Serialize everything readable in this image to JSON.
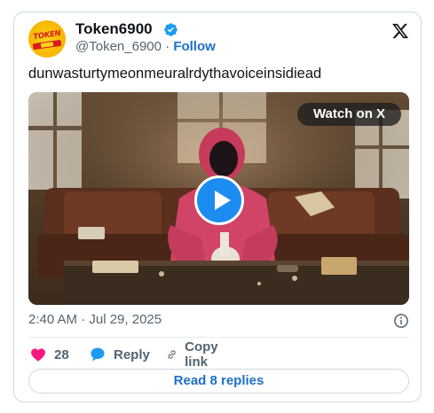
{
  "author": {
    "display_name": "Token6900",
    "handle": "@Token_6900",
    "separator": " · ",
    "follow_label": "Follow",
    "avatar_logo_text": "TOKEN"
  },
  "tweet": {
    "text": "dunwasturtymeonmeuralrdythavoiceinsidiead",
    "timestamp": "2:40 AM · Jul 29, 2025"
  },
  "media": {
    "watch_label": "Watch on X"
  },
  "actions": {
    "like_count": "28",
    "reply_label": "Reply",
    "copy_link_label": "Copy link"
  },
  "footer": {
    "read_replies_label": "Read 8 replies"
  },
  "colors": {
    "brand_blue": "#1d6fc9",
    "like_red": "#f91880",
    "play_blue": "#1d8cf0"
  },
  "icons": {
    "verified": "verified-badge-icon",
    "x_logo": "x-logo-icon",
    "info": "info-icon",
    "like": "heart-icon",
    "reply": "reply-bubble-icon",
    "copy_link": "link-icon"
  }
}
